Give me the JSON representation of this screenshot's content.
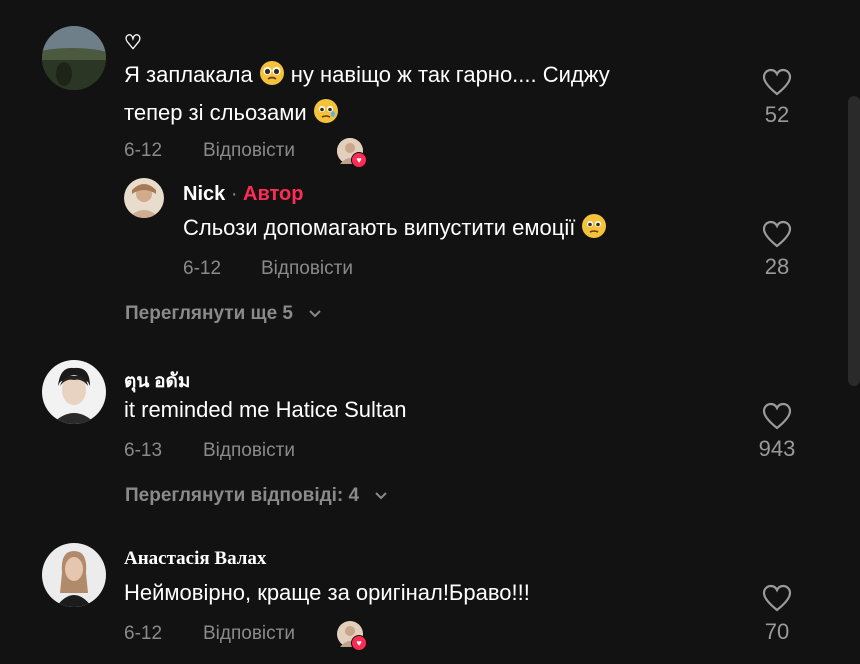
{
  "comments": [
    {
      "author": "♡",
      "text_parts": [
        "Я заплакала",
        "ну навіщо ж так гарно.... Сиджу",
        "тепер зі сльозами"
      ],
      "date": "6-12",
      "reply_label": "Відповісти",
      "likes": "52",
      "emoji1": "pleading-face-icon",
      "emoji2": "face-holding-back-tears-icon"
    },
    {
      "author": "Nick",
      "author_badge": "Автор",
      "separator": "·",
      "text": "Сльози допомагають випустити емоції",
      "date": "6-12",
      "reply_label": "Відповісти",
      "likes": "28",
      "emoji": "face-holding-back-tears-icon"
    },
    {
      "view_more": "Переглянути ще 5"
    },
    {
      "author": "ตุน อดัม",
      "text": "it reminded me Hatice Sultan",
      "date": "6-13",
      "reply_label": "Відповісти",
      "likes": "943"
    },
    {
      "view_more": "Переглянути відповіді: 4"
    },
    {
      "author": "Анастасія Валах",
      "text": "Неймовірно, краще за оригінал!Браво!!!",
      "date": "6-12",
      "reply_label": "Відповісти",
      "likes": "70"
    }
  ],
  "colors": {
    "background": "#121212",
    "accent": "#fe2c55",
    "muted": "#8a8a8a"
  }
}
